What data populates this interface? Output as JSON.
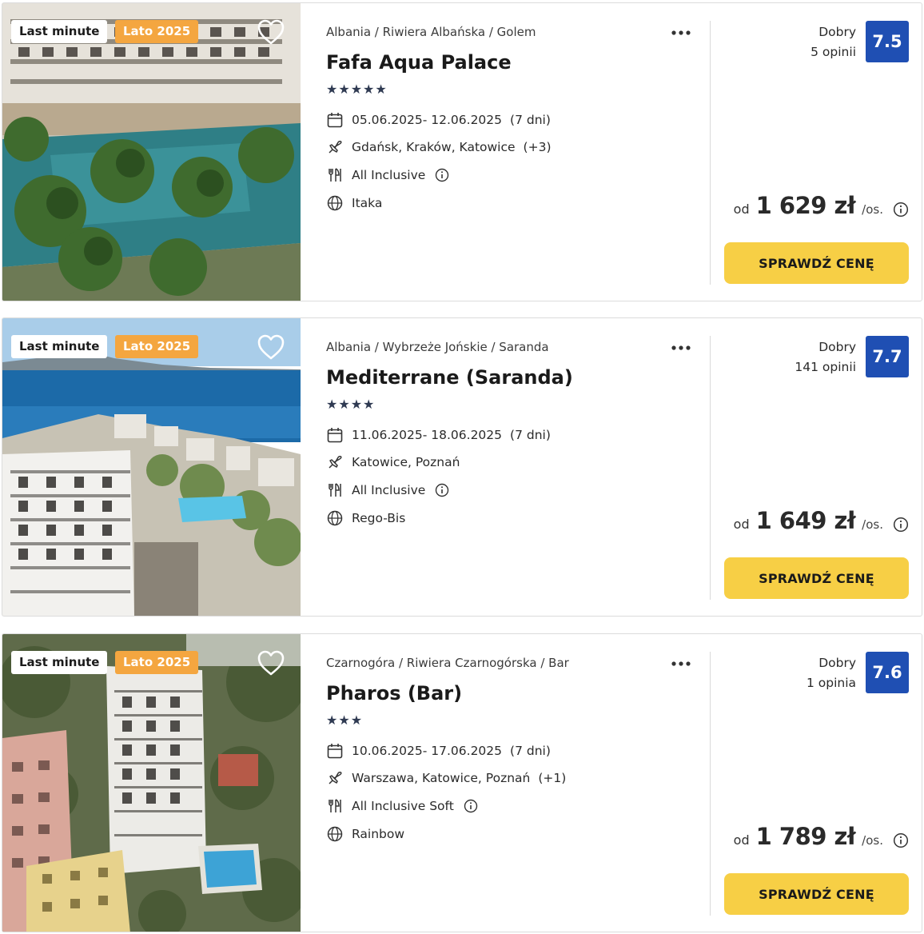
{
  "offers": [
    {
      "tags": {
        "last_minute": "Last minute",
        "season": "Lato 2025"
      },
      "breadcrumb": "Albania / Riwiera Albańska / Golem",
      "name": "Fafa Aqua Palace",
      "stars": "★★★★★",
      "star_count": 5,
      "dates": "05.06.2025- 12.06.2025",
      "duration": "(7 dni)",
      "departure": "Gdańsk, Kraków, Katowice",
      "departure_extra": "(+3)",
      "board": "All Inclusive",
      "operator": "Itaka",
      "rating_label": "Dobry",
      "reviews": "5 opinii",
      "score": "7.5",
      "price_prefix": "od",
      "price": "1 629 zł",
      "price_suffix": "/os.",
      "cta": "SPRAWDŹ CENĘ",
      "image": "hotel-pool-palms-photo"
    },
    {
      "tags": {
        "last_minute": "Last minute",
        "season": "Lato 2025"
      },
      "breadcrumb": "Albania / Wybrzeże Jońskie / Saranda",
      "name": "Mediterrane (Saranda)",
      "stars": "★★★★",
      "star_count": 4,
      "dates": "11.06.2025- 18.06.2025",
      "duration": "(7 dni)",
      "departure": "Katowice, Poznań",
      "departure_extra": "",
      "board": "All Inclusive",
      "operator": "Rego-Bis",
      "rating_label": "Dobry",
      "reviews": "141 opinii",
      "score": "7.7",
      "price_prefix": "od",
      "price": "1 649 zł",
      "price_suffix": "/os.",
      "cta": "SPRAWDŹ CENĘ",
      "image": "hotel-sea-view-photo"
    },
    {
      "tags": {
        "last_minute": "Last minute",
        "season": "Lato 2025"
      },
      "breadcrumb": "Czarnogóra / Riwiera Czarnogórska / Bar",
      "name": "Pharos (Bar)",
      "stars": "★★★",
      "star_count": 3,
      "dates": "10.06.2025- 17.06.2025",
      "duration": "(7 dni)",
      "departure": "Warszawa, Katowice, Poznań",
      "departure_extra": "(+1)",
      "board": "All Inclusive Soft",
      "operator": "Rainbow",
      "rating_label": "Dobry",
      "reviews": "1 opinia",
      "score": "7.6",
      "price_prefix": "od",
      "price": "1 789 zł",
      "price_suffix": "/os.",
      "cta": "SPRAWDŹ CENĘ",
      "image": "hotel-aerial-pool-photo"
    }
  ],
  "colors": {
    "season_tag": "#f4a640",
    "score_badge": "#1f4fb3",
    "cta": "#f7cf45",
    "stars": "#2f3a52"
  },
  "icons": [
    "heart-icon",
    "more-dots-icon",
    "calendar-icon",
    "plane-icon",
    "cutlery-icon",
    "info-icon",
    "globe-icon"
  ]
}
